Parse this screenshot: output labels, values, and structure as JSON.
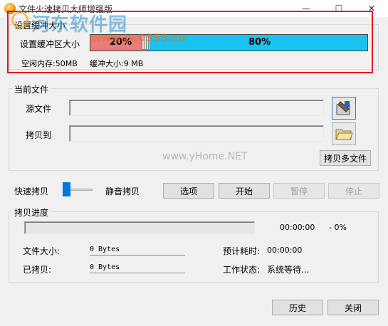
{
  "window": {
    "title": "文件火速拷贝大师增强版",
    "minimize_icon": "minimize-icon",
    "maximize_icon": "maximize-icon",
    "close_icon": "close-icon",
    "min_glyph": "—",
    "max_glyph": "☐",
    "close_glyph": "✕"
  },
  "watermark": {
    "text": "河东软件园",
    "url": "www.pc0359.cn",
    "site": "www.yHome.NET"
  },
  "buffer": {
    "group_label": "设置缓冲大小",
    "row_label": "设置缓冲区大小",
    "left_percent_label": "20%",
    "right_percent_label": "80%",
    "level": 0.2,
    "fill_color": "#e87c7c",
    "remain_color": "#18c3f0",
    "free_memory": "空闲内存:50MB",
    "buffer_size": "缓冲大小:9 MB"
  },
  "current_file": {
    "group_label": "当前文件",
    "source_label": "源文件",
    "source_value": "",
    "dest_label": "拷贝到",
    "dest_value": "",
    "source_icon": "source-file-picker-icon",
    "dest_icon": "folder-icon",
    "multi_copy_button": "拷贝多文件"
  },
  "controls": {
    "fast_copy_label": "快速拷贝",
    "silent_copy_label": "静音拷贝",
    "options_button": "选项",
    "start_button": "开始",
    "pause_button": "暂停",
    "stop_button": "停止"
  },
  "progress": {
    "group_label": "拷贝进度",
    "elapsed": "00:00:00",
    "percent": "- 0%",
    "file_size_label": "文件大小:",
    "file_size_value": "0 Bytes",
    "copied_label": "已拷贝:",
    "copied_value": "0 Bytes",
    "eta_label": "预计耗时:",
    "eta_value": "00:00:00",
    "status_label": "工作状态:",
    "status_value": "系统等待..."
  },
  "footer": {
    "history_button": "历史",
    "close_button": "关闭"
  }
}
